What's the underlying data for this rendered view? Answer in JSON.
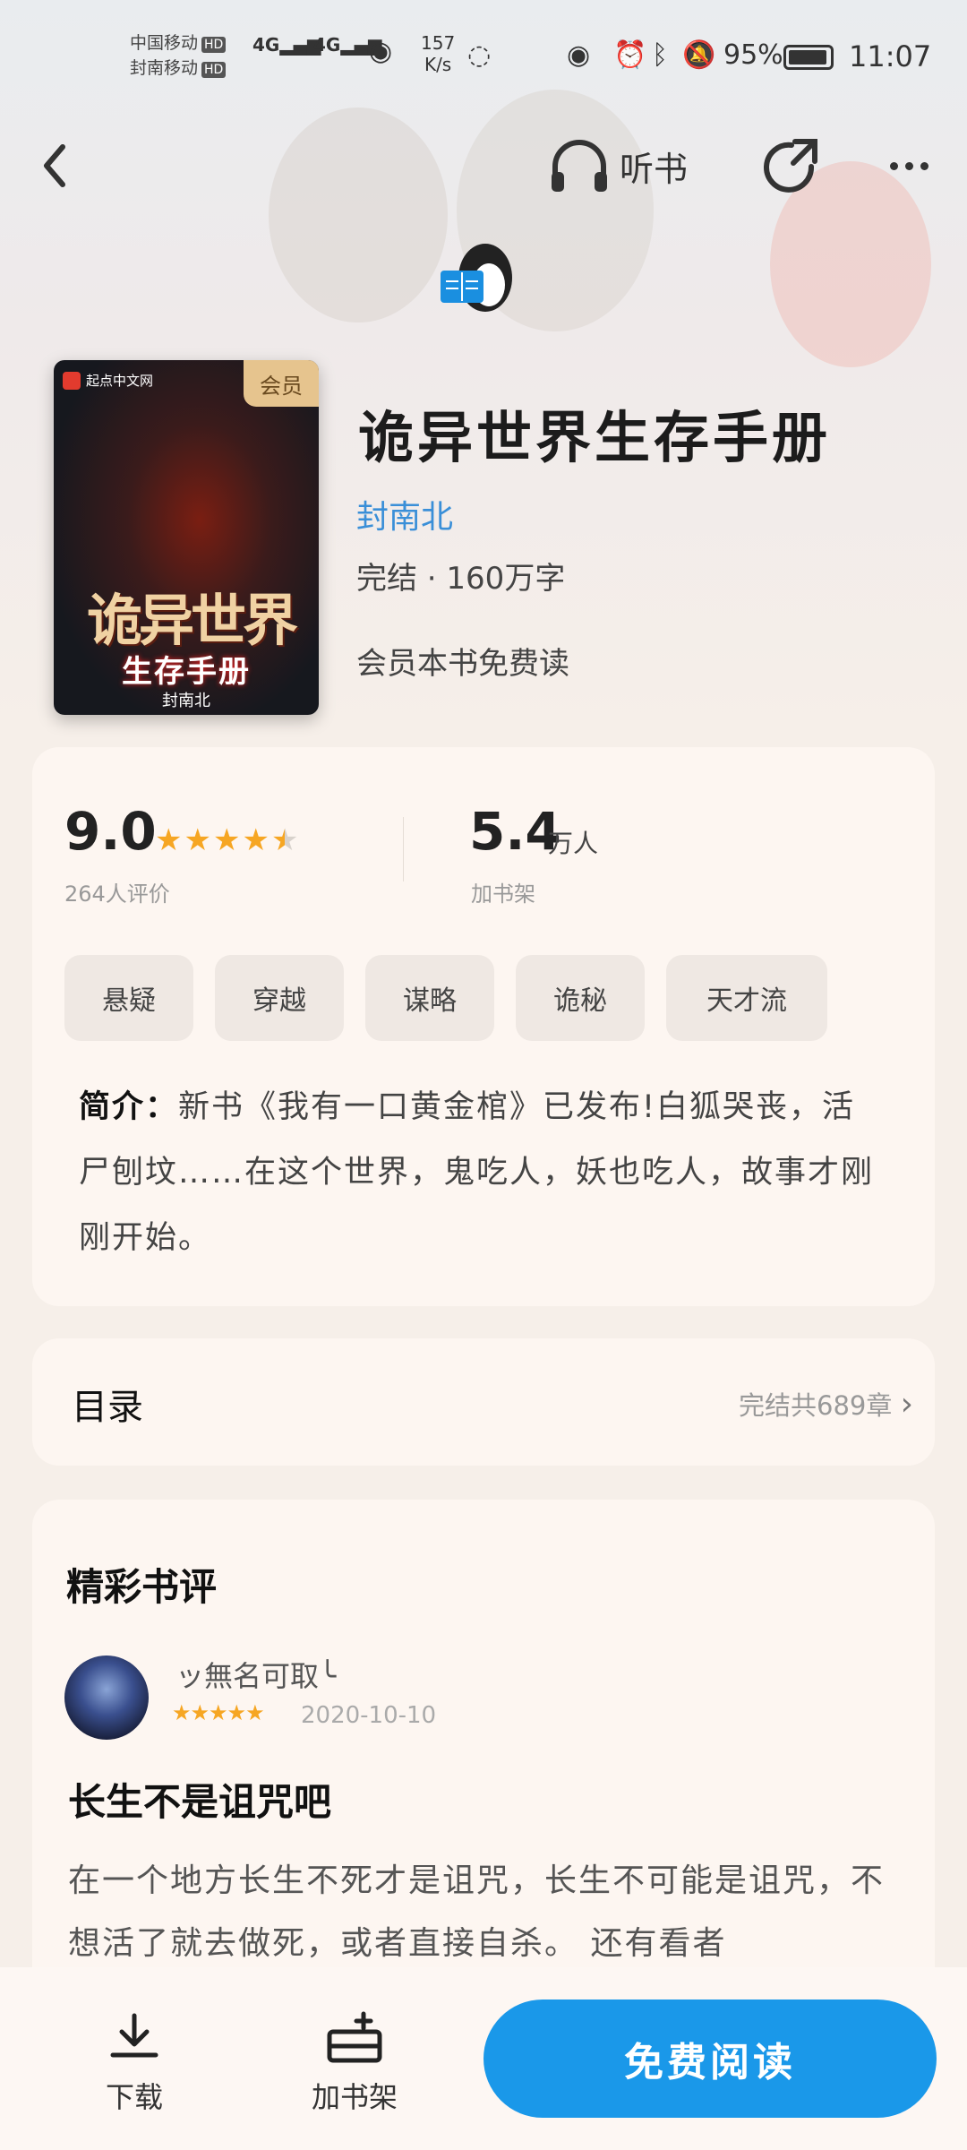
{
  "status_bar": {
    "carrier_1": "中国移动",
    "carrier_2": "封南移动",
    "hd": "HD",
    "signal": "4G",
    "speed_value": "157",
    "speed_unit": "K/s",
    "battery": "95%",
    "time": "11:07"
  },
  "nav": {
    "back_icon": "back-chevron",
    "listen_label": "听书",
    "share_icon": "share-icon",
    "more_icon": "more-icon"
  },
  "book": {
    "cover": {
      "publisher": "起点中文网",
      "vip_badge": "会员",
      "title_line1": "诡异世界",
      "title_line2": "生存手册",
      "author": "封南北"
    },
    "title": "诡异世界生存手册",
    "author": "封南北",
    "meta": "完结 · 160万字",
    "free_note": "会员本书免费读"
  },
  "stats": {
    "rating": "9.0",
    "rating_stars": 4.5,
    "rating_count": "264人评价",
    "shelf_num": "5.4",
    "shelf_unit": "万人",
    "shelf_label": "加书架"
  },
  "tags": [
    "悬疑",
    "穿越",
    "谋略",
    "诡秘",
    "天才流"
  ],
  "intro": {
    "label": "简介：",
    "text": "新书《我有一口黄金棺》已发布!白狐哭丧，活尸刨坟……在这个世界，鬼吃人，妖也吃人，故事才刚刚开始。"
  },
  "toc": {
    "label": "目录",
    "summary": "完结共689章",
    "chevron": "›"
  },
  "reviews": {
    "header": "精彩书评",
    "items": [
      {
        "user": "ッ無名可取╰",
        "stars": "★★★★★",
        "date": "2020-10-10",
        "title": "长生不是诅咒吧",
        "body": "在一个地方长生不死才是诅咒，长生不可能是诅咒，不想活了就去做死，或者直接自杀。 还有看者"
      }
    ]
  },
  "bottom_bar": {
    "download": "下载",
    "add_shelf": "加书架",
    "read": "免费阅读"
  },
  "colors": {
    "accent": "#1a98e9",
    "author_link": "#3a8fd8",
    "star": "#f6a623",
    "vip_badge": "#e6c48e"
  }
}
